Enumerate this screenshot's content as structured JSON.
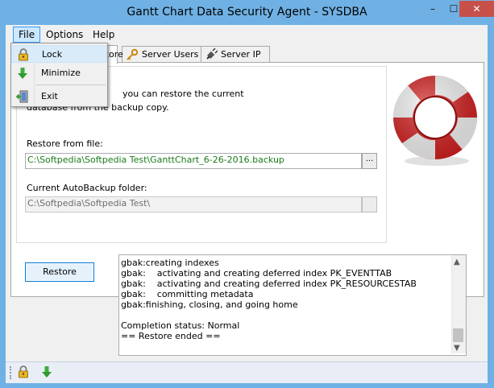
{
  "window": {
    "title": "Gantt Chart Data Security Agent - SYSDBA",
    "minimize_glyph": "–",
    "maximize_glyph": "☐",
    "close_glyph": "✕"
  },
  "menubar": {
    "items": [
      {
        "label": "File"
      },
      {
        "label": "Options"
      },
      {
        "label": "Help"
      }
    ]
  },
  "file_menu": {
    "items": [
      {
        "label": "Lock",
        "icon": "padlock-icon"
      },
      {
        "label": "Minimize",
        "icon": "green-down-arrow-icon"
      },
      {
        "label": "Exit",
        "icon": "exit-door-icon"
      }
    ]
  },
  "tabs": [
    {
      "label": "Restore",
      "active": true
    },
    {
      "label": "Server Users",
      "icon": "key-icon"
    },
    {
      "label": "Server IP",
      "icon": "plug-icon"
    }
  ],
  "restore_panel": {
    "intro_line1": "you can restore the current",
    "intro_line2": "database from the backup copy.",
    "restore_from_label": "Restore from file:",
    "restore_from_value": "C:\\Softpedia\\Softpedia Test\\GanttChart_6-26-2016.backup",
    "browse_label": "...",
    "autobackup_label": "Current AutoBackup folder:",
    "autobackup_value": "C:\\Softpedia\\Softpedia Test\\",
    "restore_button": "Restore"
  },
  "log": {
    "lines": [
      "gbak:creating indexes",
      "gbak:    activating and creating deferred index PK_EVENTTAB",
      "gbak:    activating and creating deferred index PK_RESOURCESTAB",
      "gbak:    committing metadata",
      "gbak:finishing, closing, and going home",
      "",
      "Completion status: Normal",
      "== Restore ended =="
    ]
  },
  "colors": {
    "accent": "#0078d7",
    "path_green": "#1a7b1a",
    "close_red": "#c7504a",
    "window_frame": "#6fb1e4"
  }
}
